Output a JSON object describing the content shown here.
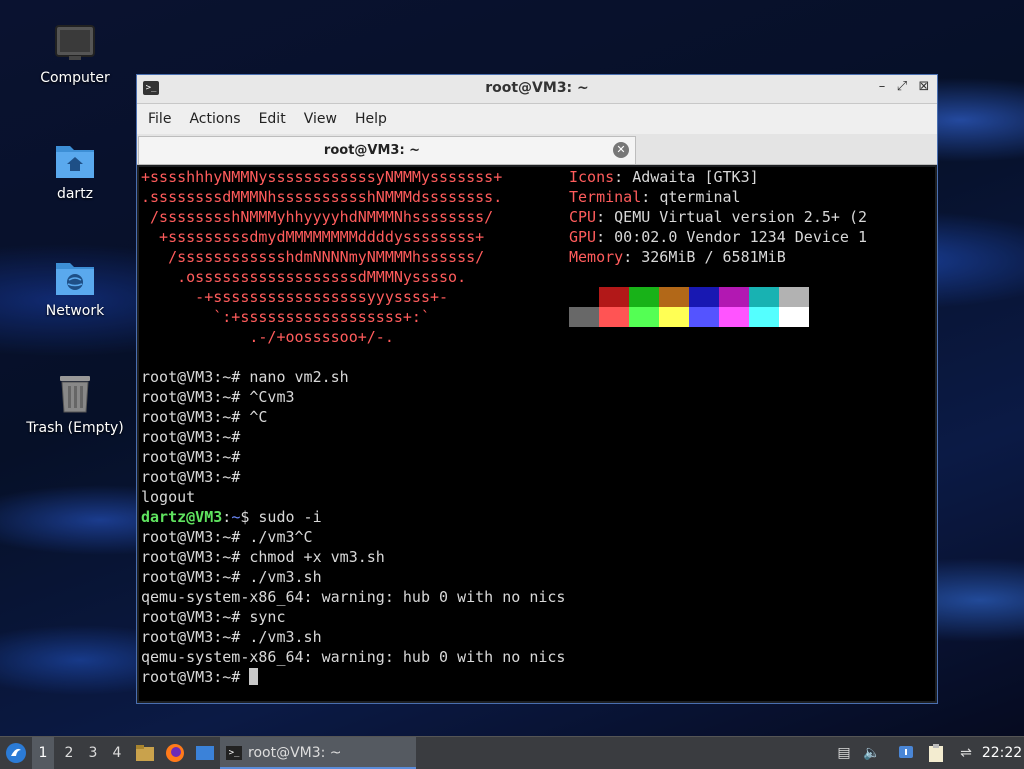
{
  "desktop": {
    "icons": [
      {
        "label": "Computer",
        "icon": "computer-icon"
      },
      {
        "label": "dartz",
        "icon": "home-folder-icon"
      },
      {
        "label": "Network",
        "icon": "network-folder-icon"
      },
      {
        "label": "Trash (Empty)",
        "icon": "trash-icon"
      }
    ]
  },
  "window": {
    "title": "root@VM3: ~",
    "menu": [
      "File",
      "Actions",
      "Edit",
      "View",
      "Help"
    ],
    "tab_label": "root@VM3: ~"
  },
  "terminal": {
    "logo_lines": [
      "+sssshhhyNMMNyssssssssssssyNMMMysssssss+",
      ".ssssssssdMMMNhsssssssssshNMMMdssssssss.",
      " /sssssssshNMMMyhhyyyyhdNMMMNhssssssss/",
      "  +sssssssssdmydMMMMMMMMddddyssssssss+",
      "   /sssssssssssshdmNNNNmyNMMMMhssssss/",
      "    .ossssssssssssssssssdMMMNysssso.",
      "      -+sssssssssssssssssyyyssss+-",
      "        `:+ssssssssssssssssss+:`",
      "            .-/+oossssoo+/-."
    ],
    "info": [
      {
        "key": "Icons",
        "value": "Adwaita [GTK3]"
      },
      {
        "key": "Terminal",
        "value": "qterminal"
      },
      {
        "key": "CPU",
        "value": "QEMU Virtual version 2.5+ (2"
      },
      {
        "key": "GPU",
        "value": "00:02.0 Vendor 1234 Device 1"
      },
      {
        "key": "Memory",
        "value": "326MiB / 6581MiB"
      }
    ],
    "palette_top": [
      "#000000",
      "#b21818",
      "#18b218",
      "#b26818",
      "#1818b2",
      "#b218b2",
      "#18b2b2",
      "#b2b2b2"
    ],
    "palette_bottom": [
      "#686868",
      "#ff5454",
      "#54ff54",
      "#ffff54",
      "#5454ff",
      "#ff54ff",
      "#54ffff",
      "#ffffff"
    ],
    "lines": [
      {
        "prompt": "root@VM3:~#",
        "text": " nano vm2.sh"
      },
      {
        "prompt": "root@VM3:~#",
        "text": " ^Cvm3"
      },
      {
        "prompt": "root@VM3:~#",
        "text": " ^C"
      },
      {
        "prompt": "root@VM3:~#",
        "text": ""
      },
      {
        "prompt": "root@VM3:~#",
        "text": ""
      },
      {
        "prompt": "root@VM3:~#",
        "text": ""
      },
      {
        "prompt": "",
        "text": "logout"
      },
      {
        "prompt": "",
        "text": "",
        "user": "dartz@VM3",
        "sep": ":",
        "path": "~",
        "tail": "$ sudo -i"
      },
      {
        "prompt": "root@VM3:~#",
        "text": " ./vm3^C"
      },
      {
        "prompt": "root@VM3:~#",
        "text": " chmod +x vm3.sh"
      },
      {
        "prompt": "root@VM3:~#",
        "text": " ./vm3.sh"
      },
      {
        "prompt": "",
        "text": "qemu-system-x86_64: warning: hub 0 with no nics"
      },
      {
        "prompt": "root@VM3:~#",
        "text": " sync"
      },
      {
        "prompt": "root@VM3:~#",
        "text": " ./vm3.sh"
      },
      {
        "prompt": "",
        "text": "qemu-system-x86_64: warning: hub 0 with no nics"
      },
      {
        "prompt": "root@VM3:~#",
        "text": " "
      }
    ]
  },
  "taskbar": {
    "workspaces": [
      "1",
      "2",
      "3",
      "4"
    ],
    "task_label": "root@VM3: ~",
    "clock": "22:22"
  }
}
